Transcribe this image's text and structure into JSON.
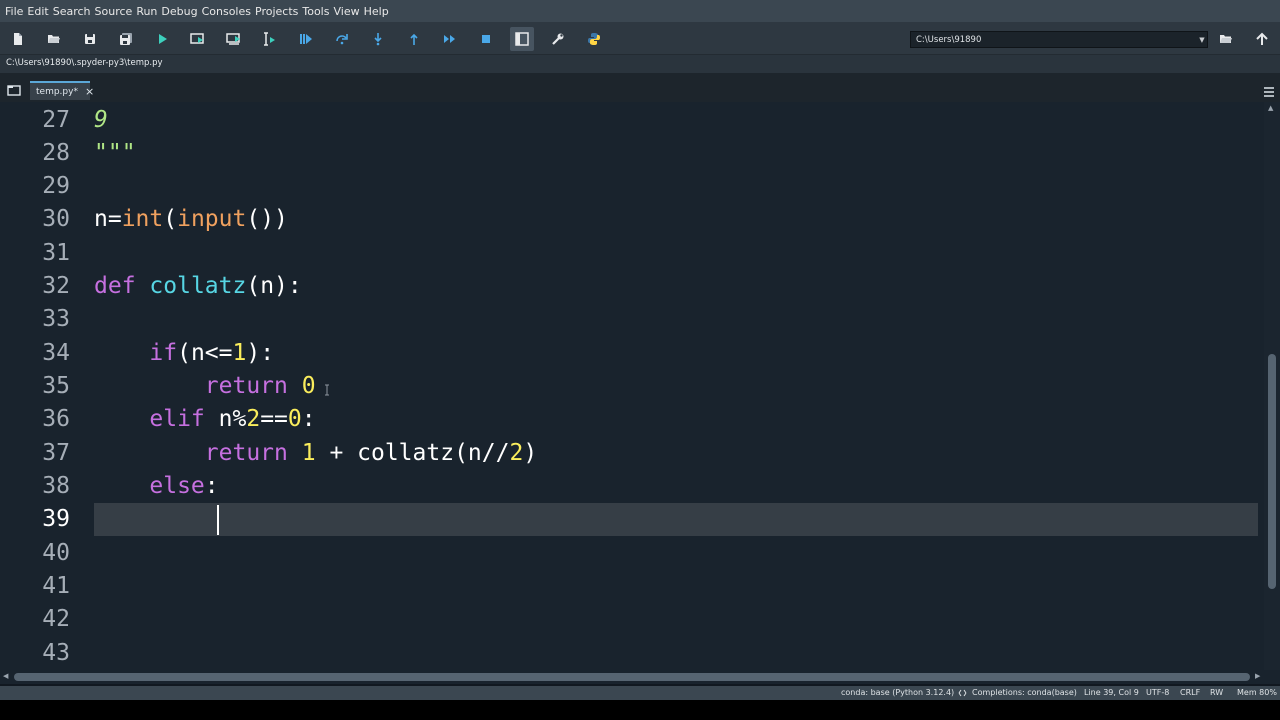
{
  "menu": [
    "File",
    "Edit",
    "Search",
    "Source",
    "Run",
    "Debug",
    "Consoles",
    "Projects",
    "Tools",
    "View",
    "Help"
  ],
  "toolbar": {
    "buttons": [
      "new-file",
      "open-file",
      "save-file",
      "save-all",
      "run-file",
      "run-cell",
      "run-cell-advance",
      "run-selection",
      "debug-file",
      "debug-step-over",
      "debug-step-into",
      "debug-step-return",
      "debug-continue",
      "debug-stop",
      "maximize-pane",
      "preferences",
      "pythonpath-manager"
    ],
    "working_directory": "C:\\Users\\91890"
  },
  "editor": {
    "file_path": "C:\\Users\\91890\\.spyder-py3\\temp.py",
    "tab_label": "temp.py*",
    "line_numbers": [
      "27",
      "28",
      "29",
      "30",
      "31",
      "32",
      "33",
      "34",
      "35",
      "36",
      "37",
      "38",
      "39",
      "40",
      "41",
      "42",
      "43"
    ],
    "current_line": "39",
    "code": {
      "l27": "9",
      "l28": "\"\"\"",
      "l30_var": "n=",
      "l30_int": "int",
      "l30_paren1": "(",
      "l30_input": "input",
      "l30_rest": "())",
      "l32_def": "def",
      "l32_name": "collatz",
      "l32_rest": "(n):",
      "l34_if": "if",
      "l34_a": "(n<=",
      "l34_num": "1",
      "l34_b": "):",
      "l35_ret": "return",
      "l35_num": "0",
      "l36_elif": "elif",
      "l36_a": " n%",
      "l36_n1": "2",
      "l36_b": "==",
      "l36_n2": "0",
      "l36_c": ":",
      "l37_ret": "return",
      "l37_n1": "1",
      "l37_a": " + collatz(n//",
      "l37_n2": "2",
      "l37_b": ")",
      "l38_else": "else",
      "l38_c": ":"
    }
  },
  "status": {
    "env": "conda: base (Python 3.12.4)",
    "completions": "Completions: conda(base)",
    "position": "Line 39, Col 9",
    "encoding": "UTF-8",
    "eol": "CRLF",
    "permissions": "RW",
    "memory": "Mem 80%"
  },
  "colors": {
    "editor_bg": "#19232d",
    "keyword": "#c670e0",
    "builtin": "#f0a15f",
    "function_name": "#57d6e4",
    "number": "#faed5c",
    "string": "#b0e686"
  }
}
